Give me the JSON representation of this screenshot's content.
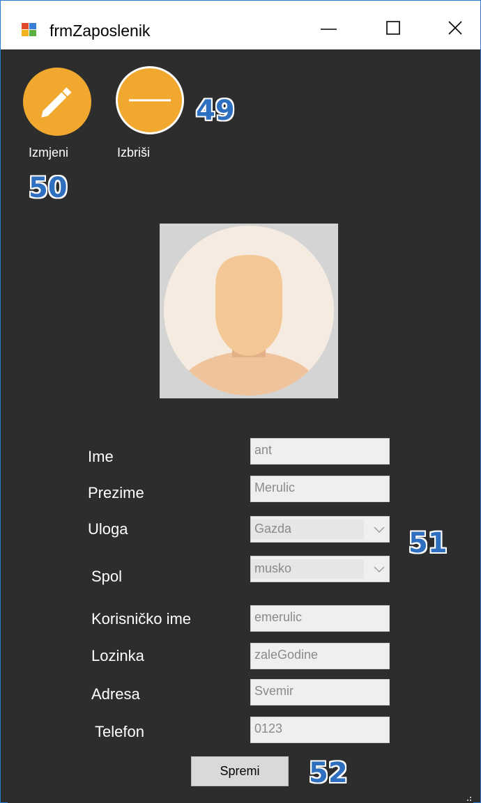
{
  "window": {
    "title": "frmZaposlenik",
    "controls": {
      "minimize": "—",
      "maximize": "☐",
      "close": "✕"
    }
  },
  "toolbar": {
    "edit_label": "Izmjeni",
    "delete_label": "Izbriši",
    "edit_icon": "pencil-icon",
    "delete_icon": "minus-icon",
    "accent_color": "#f1a82f"
  },
  "annotations": {
    "a49": "49",
    "a50": "50",
    "a51": "51",
    "a52": "52"
  },
  "form": {
    "ime": {
      "label": "Ime",
      "value": "ant"
    },
    "prezime": {
      "label": "Prezime",
      "value": "Merulic"
    },
    "uloga": {
      "label": "Uloga",
      "value": "Gazda"
    },
    "spol": {
      "label": "Spol",
      "value": "musko"
    },
    "korisnicko_ime": {
      "label": "Korisničko ime",
      "value": "emerulic"
    },
    "lozinka": {
      "label": "Lozinka",
      "value": "zaleGodine"
    },
    "adresa": {
      "label": "Adresa",
      "value": "Svemir"
    },
    "telefon": {
      "label": "Telefon",
      "value": "0123"
    }
  },
  "actions": {
    "save_label": "Spremi"
  }
}
